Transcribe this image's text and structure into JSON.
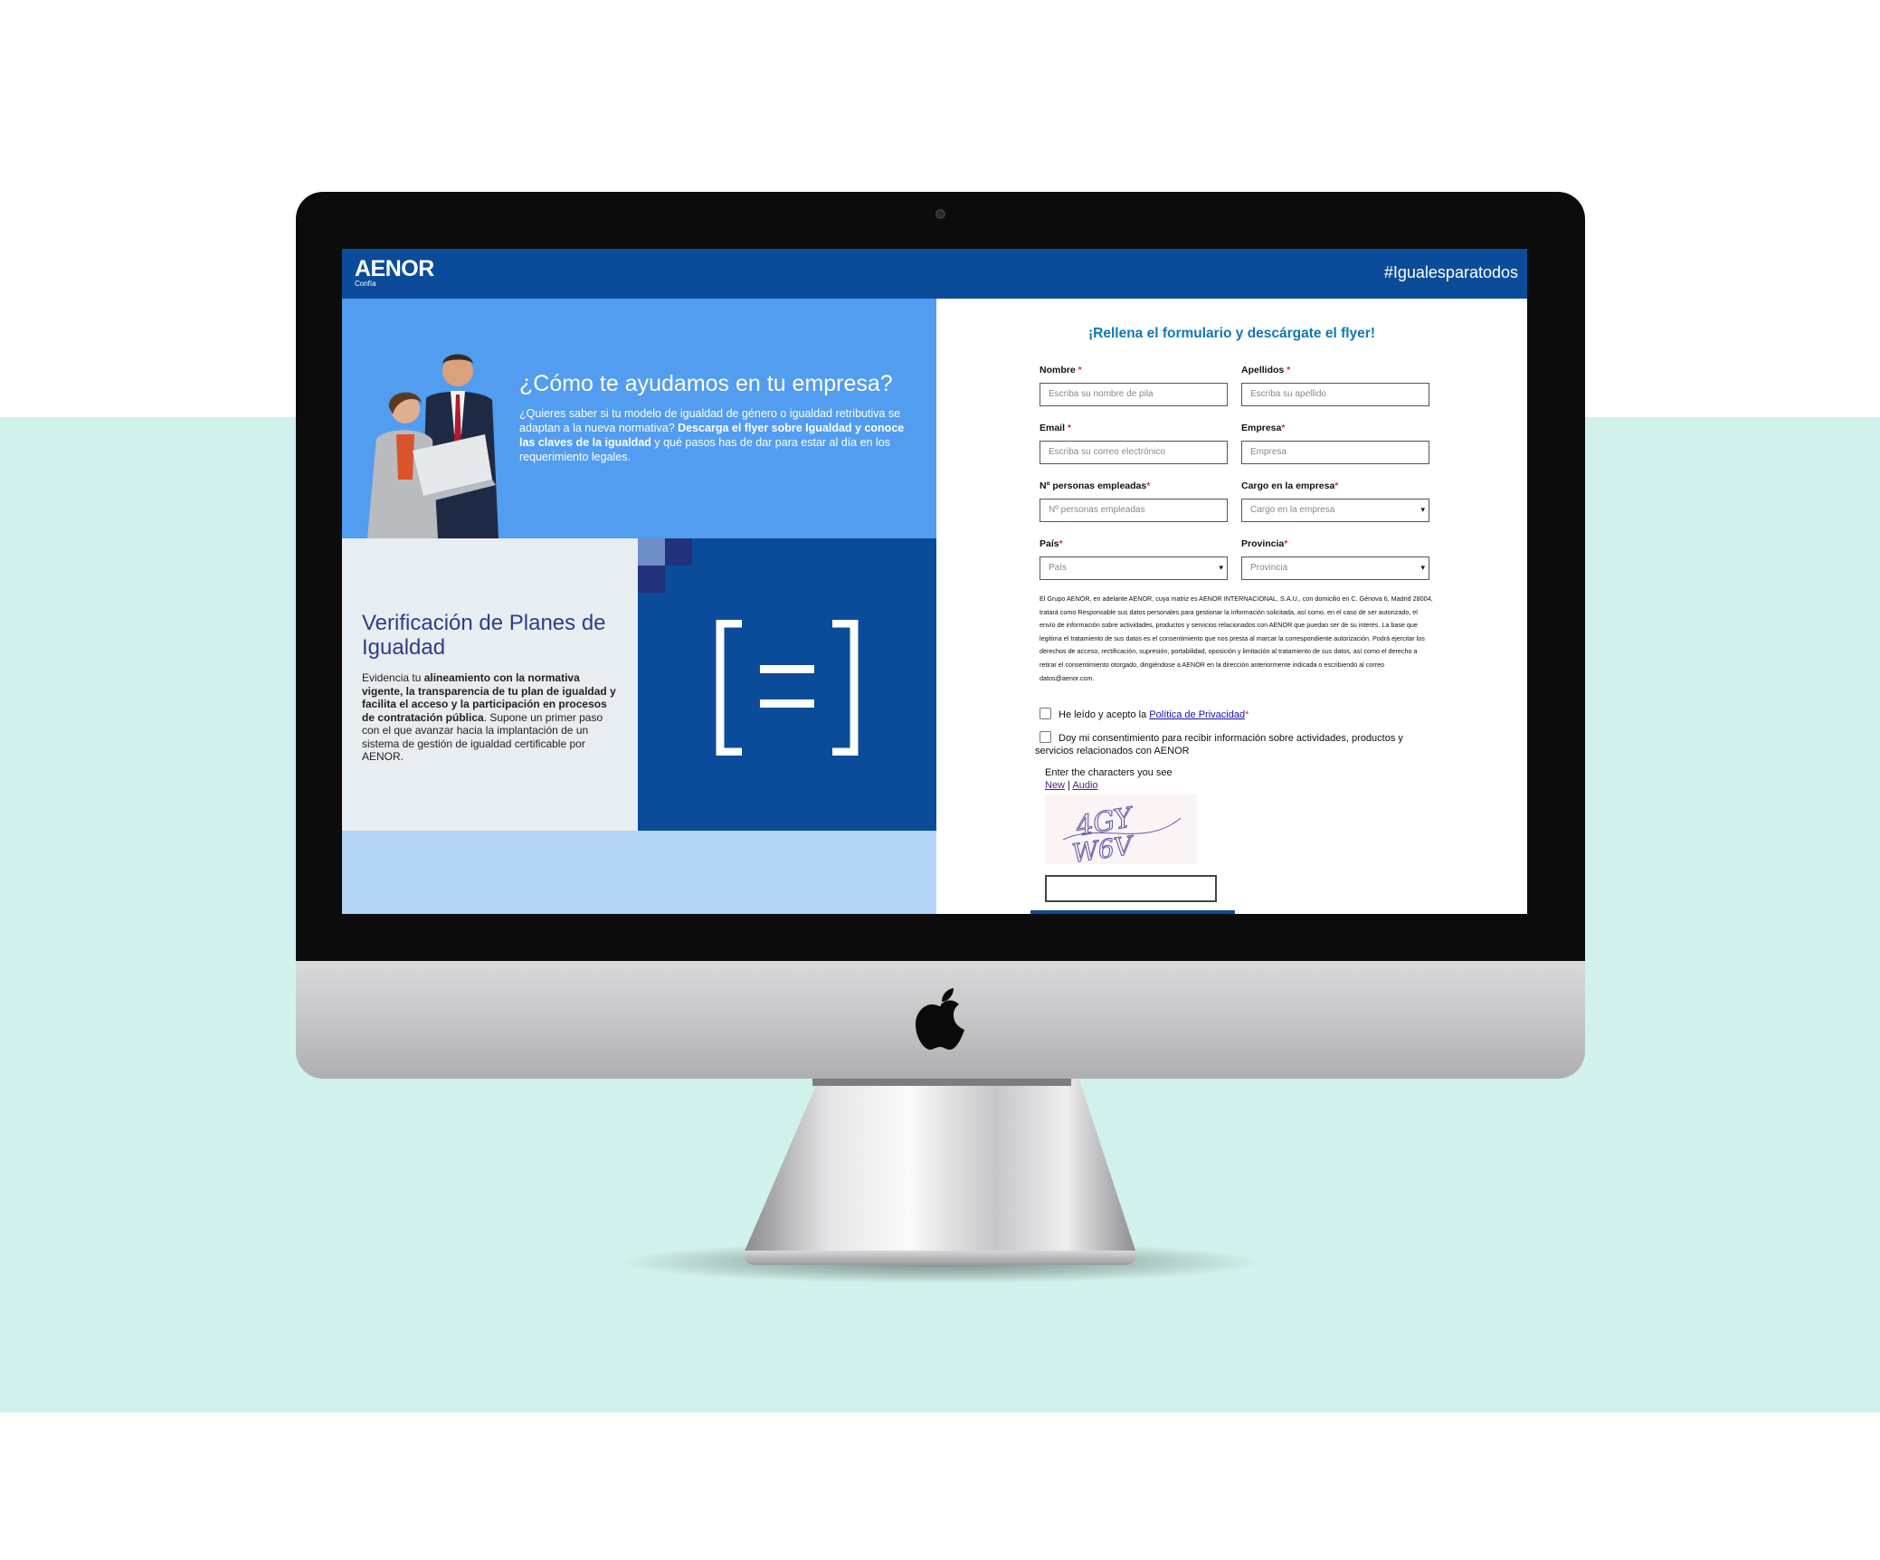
{
  "colors": {
    "mint_background": "#d1f1ec",
    "topbar_blue": "#0a4c9a",
    "hero_blue": "#529def",
    "light_blue": "#b4d5f6",
    "form_title_blue": "#0f77b8",
    "verif_title": "#2c3e8a"
  },
  "header": {
    "logo_text": "AENOR",
    "logo_sub": "Confía",
    "hashtag": "#Igualesparatodos"
  },
  "hero": {
    "title": "¿Cómo te ayudamos en tu empresa?",
    "text_1": "¿Quieres saber si tu modelo de igualdad de género o igualdad retributiva se adaptan a la nueva normativa? ",
    "text_bold": "Descarga el flyer sobre Igualdad y conoce las claves de la igualdad",
    "text_2": " y qué pasos has de dar para estar al día en los requerimiento legales."
  },
  "verification": {
    "title": "Verificación de Planes de Igualdad",
    "text_1": "Evidencia tu ",
    "text_bold": "alineamiento con la normativa vigente, la transparencia de tu plan de igualdad y facilita el acceso y la participación en procesos de contratación pública",
    "text_2": ". Supone un primer paso con el que avanzar hacia la implantación de un sistema de gestión de igualdad certificable por AENOR."
  },
  "form": {
    "title": "¡Rellena el formulario y descárgate el flyer!",
    "fields": {
      "nombre": {
        "label": "Nombre",
        "required_mark": " *",
        "placeholder": "Escriba su nombre de pila"
      },
      "apellidos": {
        "label": "Apellidos",
        "required_mark": " *",
        "placeholder": "Escriba su apellido"
      },
      "email": {
        "label": "Email",
        "required_mark": " *",
        "placeholder": "Escriba su correo electrónico"
      },
      "empresa": {
        "label": "Empresa",
        "required_mark": "*",
        "placeholder": "Empresa"
      },
      "empleados": {
        "label": "Nº personas empleadas",
        "required_mark": "*",
        "placeholder": "Nº personas empleadas"
      },
      "cargo": {
        "label": "Cargo en la empresa",
        "required_mark": "*",
        "placeholder": "Cargo en la empresa"
      },
      "pais": {
        "label": "País",
        "required_mark": "*",
        "placeholder": "País"
      },
      "provincia": {
        "label": "Provincia",
        "required_mark": "*",
        "placeholder": "Provincia"
      }
    },
    "legal_text": "El Grupo AENOR, en adelante AENOR, cuya matriz es AENOR INTERNACIONAL, S.A.U., con domicilio en C. Génova 6, Madrid 28004, tratará como Responsable sus datos personales para gestionar la información solicitada, así como, en el caso de ser autorizado, el envío de información sobre actividades, productos y servicios relacionados con AENOR que puedan ser de su interés. La base que legitima el tratamiento de sus datos es el consentimiento que nos presta al marcar la correspondiente autorización. Podrá ejercitar los derechos de acceso, rectificación, supresión, portabilidad, oposición y limitación al tratamiento de sus datos, así como el derecho a retirar el consentimiento otorgado, dirigiéndose a AENOR en la dirección anteriormente indicada o escribiendo al correo datos@aenor.com.",
    "privacy_prefix": "He leído y acepto la ",
    "privacy_link": "Política de Privacidad",
    "privacy_req": "*",
    "consent_text": "Doy mi consentimiento para recibir información sobre actividades, productos y servicios relacionados con AENOR",
    "captcha": {
      "label": "Enter the characters you see",
      "new_link": "New",
      "separator": " | ",
      "audio_link": "Audio",
      "image_text": "4GY W6V"
    }
  }
}
